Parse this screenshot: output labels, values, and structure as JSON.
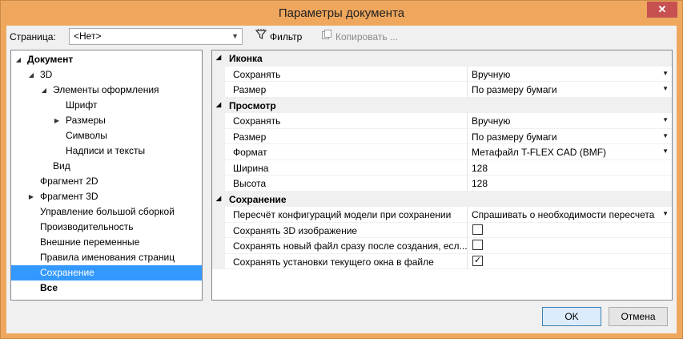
{
  "window": {
    "title": "Параметры документа",
    "close": "✕"
  },
  "toolbar": {
    "page_label": "Страница:",
    "page_value": "<Нет>",
    "filter_label": "Фильтр",
    "copy_label": "Копировать ..."
  },
  "tree": [
    {
      "label": "Документ",
      "level": 0,
      "expander": "◢",
      "bold": true,
      "selected": false
    },
    {
      "label": "3D",
      "level": 1,
      "expander": "◢",
      "bold": false,
      "selected": false
    },
    {
      "label": "Элементы оформления",
      "level": 2,
      "expander": "◢",
      "bold": false,
      "selected": false
    },
    {
      "label": "Шрифт",
      "level": 3,
      "expander": "",
      "bold": false,
      "selected": false
    },
    {
      "label": "Размеры",
      "level": 3,
      "expander": "▶",
      "bold": false,
      "selected": false
    },
    {
      "label": "Символы",
      "level": 3,
      "expander": "",
      "bold": false,
      "selected": false
    },
    {
      "label": "Надписи и тексты",
      "level": 3,
      "expander": "",
      "bold": false,
      "selected": false
    },
    {
      "label": "Вид",
      "level": 2,
      "expander": "",
      "bold": false,
      "selected": false
    },
    {
      "label": "Фрагмент 2D",
      "level": 1,
      "expander": "",
      "bold": false,
      "selected": false
    },
    {
      "label": "Фрагмент 3D",
      "level": 1,
      "expander": "▶",
      "bold": false,
      "selected": false
    },
    {
      "label": "Управление большой сборкой",
      "level": 1,
      "expander": "",
      "bold": false,
      "selected": false
    },
    {
      "label": "Производительность",
      "level": 1,
      "expander": "",
      "bold": false,
      "selected": false
    },
    {
      "label": "Внешние переменные",
      "level": 1,
      "expander": "",
      "bold": false,
      "selected": false
    },
    {
      "label": "Правила именования страниц",
      "level": 1,
      "expander": "",
      "bold": false,
      "selected": false
    },
    {
      "label": "Сохранение",
      "level": 1,
      "expander": "",
      "bold": false,
      "selected": true
    },
    {
      "label": "Все",
      "level": 1,
      "expander": "",
      "bold": true,
      "selected": false
    }
  ],
  "properties": [
    {
      "kind": "category",
      "label": "Иконка",
      "expander": "◢"
    },
    {
      "kind": "prop",
      "name": "Сохранять",
      "value": "Вручную",
      "dropdown": true
    },
    {
      "kind": "prop",
      "name": "Размер",
      "value": "По размеру бумаги",
      "dropdown": true
    },
    {
      "kind": "category",
      "label": "Просмотр",
      "expander": "◢"
    },
    {
      "kind": "prop",
      "name": "Сохранять",
      "value": "Вручную",
      "dropdown": true
    },
    {
      "kind": "prop",
      "name": "Размер",
      "value": "По размеру бумаги",
      "dropdown": true
    },
    {
      "kind": "prop",
      "name": "Формат",
      "value": "Метафайл T-FLEX CAD (BMF)",
      "dropdown": true
    },
    {
      "kind": "prop",
      "name": "Ширина",
      "value": "128",
      "dropdown": false
    },
    {
      "kind": "prop",
      "name": "Высота",
      "value": "128",
      "dropdown": false
    },
    {
      "kind": "category",
      "label": "Сохранение",
      "expander": "◢"
    },
    {
      "kind": "prop",
      "name": "Пересчёт конфигураций модели при сохранении",
      "value": "Спрашивать о необходимости пересчета",
      "dropdown": true
    },
    {
      "kind": "check",
      "name": "Сохранять 3D изображение",
      "checked": false
    },
    {
      "kind": "check",
      "name": "Сохранять новый файл сразу после создания, есл...",
      "checked": false
    },
    {
      "kind": "check",
      "name": "Сохранять установки текущего окна в файле",
      "checked": true
    }
  ],
  "buttons": {
    "ok": "OK",
    "cancel": "Отмена"
  },
  "icons": {
    "dropdown": "▾",
    "check": "✓",
    "filter": "filter-icon",
    "copy": "copy-icon"
  },
  "colors": {
    "frame": "#efa75e",
    "selection": "#3399ff"
  }
}
